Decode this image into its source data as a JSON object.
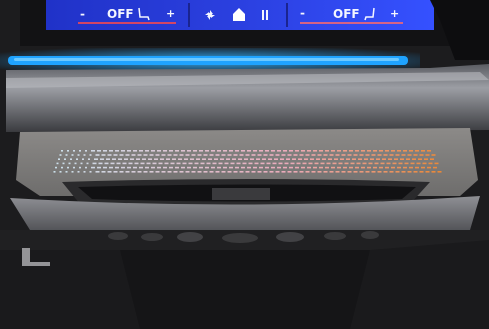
{
  "climate": {
    "driver": {
      "minus": "-",
      "status": "OFF",
      "plus": "+",
      "seat_heat_icon": "heated-seat-icon"
    },
    "passenger": {
      "minus": "-",
      "status": "OFF",
      "plus": "+",
      "seat_heat_icon": "heated-seat-icon"
    },
    "center_icons": [
      "fan-icon",
      "home-icon",
      "defrost-icon"
    ]
  },
  "colors": {
    "screen_background": "#2a3dd8",
    "ambient_light": "#1fa3ff",
    "gradient_start": "#d9f2ff",
    "gradient_mid": "#ffb3c7",
    "gradient_end": "#ff8a2a"
  }
}
